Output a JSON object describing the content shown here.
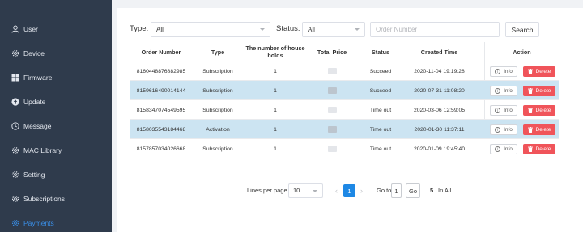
{
  "sidebar": {
    "items": [
      {
        "label": "User",
        "icon": "user-icon"
      },
      {
        "label": "Device",
        "icon": "gear-icon"
      },
      {
        "label": "Firmware",
        "icon": "grid-icon"
      },
      {
        "label": "Update",
        "icon": "upload-icon"
      },
      {
        "label": "Message",
        "icon": "clock-icon"
      },
      {
        "label": "MAC Library",
        "icon": "gear-icon"
      },
      {
        "label": "Setting",
        "icon": "gear-icon"
      },
      {
        "label": "Subscriptions",
        "icon": "gear-icon"
      },
      {
        "label": "Payments",
        "icon": "gear-icon",
        "active": true
      }
    ],
    "bg": "#2f3b4c",
    "active_color": "#3a8ee6"
  },
  "filters": {
    "type_label": "Type:",
    "type_value": "All",
    "status_label": "Status:",
    "status_value": "All",
    "order_placeholder": "Order Number",
    "search_label": "Search"
  },
  "table": {
    "headers": {
      "order_number": "Order Number",
      "type": "Type",
      "house_holds": "The number of house holds",
      "total_price": "Total Price",
      "status": "Status",
      "created_time": "Created Time",
      "action": "Action"
    },
    "rows": [
      {
        "order": "8160448876882985",
        "type": "Subscription",
        "holds": "1",
        "status": "Succeed",
        "time": "2020-11-04 19:19:28",
        "highlight": false
      },
      {
        "order": "8159616490014144",
        "type": "Subscription",
        "holds": "1",
        "status": "Succeed",
        "time": "2020-07-31 11:08:20",
        "highlight": true
      },
      {
        "order": "8158347074549595",
        "type": "Subscription",
        "holds": "1",
        "status": "Time out",
        "time": "2020-03-06 12:59:05",
        "highlight": false
      },
      {
        "order": "8158035543184468",
        "type": "Activation",
        "holds": "1",
        "status": "Time out",
        "time": "2020-01-30 11:37:11",
        "highlight": true
      },
      {
        "order": "8157857034026668",
        "type": "Subscription",
        "holds": "1",
        "status": "Time out",
        "time": "2020-01-09 19:45:40",
        "highlight": false
      }
    ],
    "info_label": "Info",
    "delete_label": "Delete",
    "highlight_color": "#cce4f2",
    "delete_color": "#f0545a"
  },
  "pagination": {
    "lines_per_page_label": "Lines per page",
    "lines_per_page_value": "10",
    "current_page": "1",
    "goto_label": "Go to",
    "goto_value": "1",
    "go_label": "Go",
    "total_count": "5",
    "total_suffix": "In All",
    "accent": "#1e88e5"
  }
}
